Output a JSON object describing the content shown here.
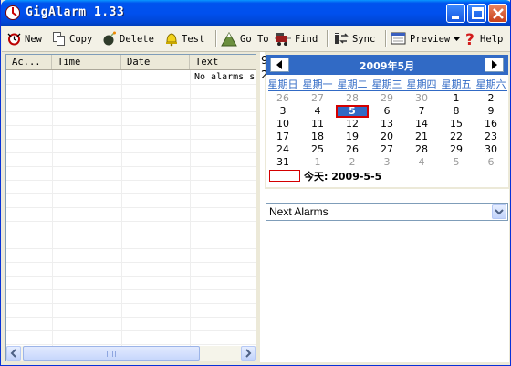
{
  "window": {
    "title": "GigAlarm 1.33"
  },
  "toolbar": {
    "new": "New",
    "copy": "Copy",
    "delete": "Delete",
    "test": "Test",
    "goto": "Go To",
    "find": "Find",
    "sync": "Sync",
    "preview": "Preview",
    "help": "Help"
  },
  "list": {
    "columns": [
      "Ac...",
      "Time",
      "Date",
      "Text"
    ],
    "empty_text": "No alarms s"
  },
  "calendar": {
    "month_label": "2009年5月",
    "weekdays": [
      "星期日",
      "星期一",
      "星期二",
      "星期三",
      "星期四",
      "星期五",
      "星期六"
    ],
    "weeks": [
      [
        "26",
        "27",
        "28",
        "29",
        "30",
        "1",
        "2"
      ],
      [
        "3",
        "4",
        "5",
        "6",
        "7",
        "8",
        "9"
      ],
      [
        "10",
        "11",
        "12",
        "13",
        "14",
        "15",
        "16"
      ],
      [
        "17",
        "18",
        "19",
        "20",
        "21",
        "22",
        "23"
      ],
      [
        "24",
        "25",
        "26",
        "27",
        "28",
        "29",
        "30"
      ],
      [
        "31",
        "1",
        "2",
        "3",
        "4",
        "5",
        "6"
      ]
    ],
    "selected_day": "5",
    "today_label": "今天: 2009-5-5"
  },
  "edge_glyphs": [
    "9",
    "2"
  ],
  "next_alarms": {
    "selected": "Next Alarms"
  },
  "colors": {
    "titlebar": "#0053ee",
    "calendar_header": "#316ac5",
    "selection": "#316ac5",
    "today_outline": "#d40000"
  },
  "icons": [
    "app-clock-icon",
    "new-alarm-icon",
    "copy-icon",
    "bomb-icon",
    "bell-icon",
    "mountain-icon",
    "truck-icon",
    "sync-icon",
    "preview-icon",
    "help-icon"
  ]
}
